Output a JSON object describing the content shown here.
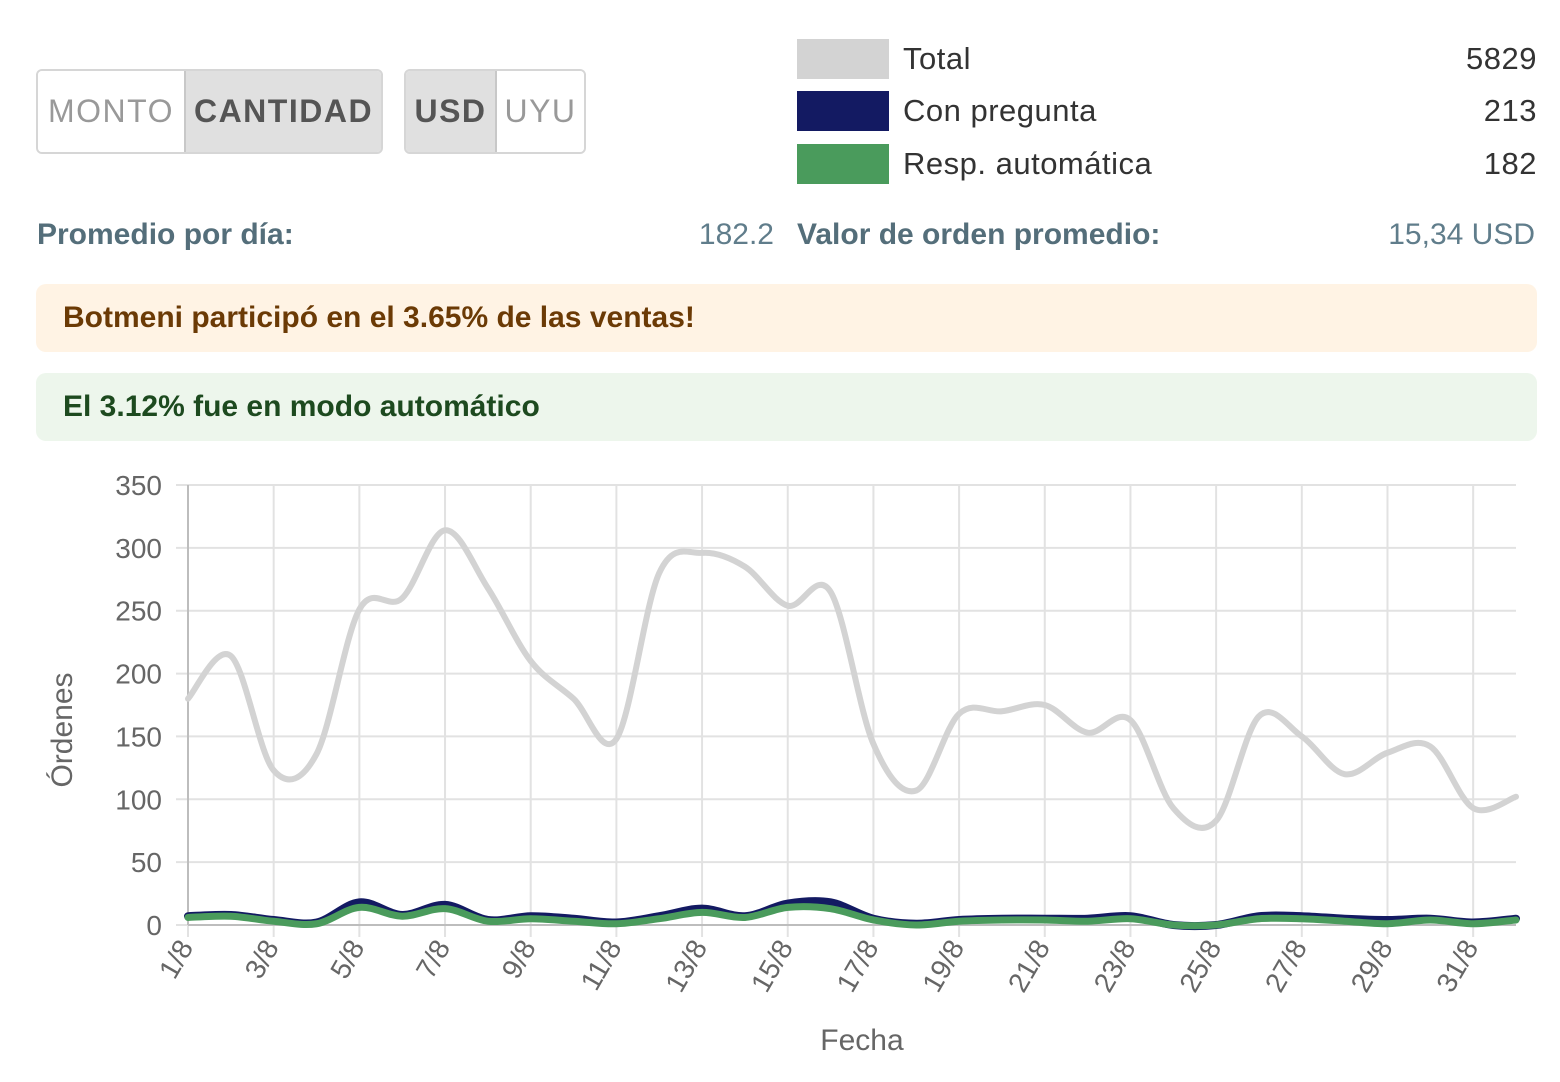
{
  "toggles": {
    "metric": {
      "options": [
        "MONTO",
        "CANTIDAD"
      ],
      "selected": "CANTIDAD"
    },
    "currency": {
      "options": [
        "USD",
        "UYU"
      ],
      "selected": "USD"
    }
  },
  "legend": [
    {
      "label": "Total",
      "value": "5829",
      "color": "#d3d3d3"
    },
    {
      "label": "Con pregunta",
      "value": "213",
      "color": "#131a62"
    },
    {
      "label": "Resp. automática",
      "value": "182",
      "color": "#4a9b5c"
    }
  ],
  "stats": {
    "avg_per_day_label": "Promedio por día:",
    "avg_per_day_value": "182.2",
    "avg_order_label": "Valor de orden promedio:",
    "avg_order_value": "15,34 USD"
  },
  "alerts": {
    "participation": "Botmeni participó en el 3.65% de las ventas!",
    "automatic": "El 3.12% fue en modo automático"
  },
  "chart_data": {
    "type": "line",
    "xlabel": "Fecha",
    "ylabel": "Órdenes",
    "ylim": [
      0,
      350
    ],
    "yticks": [
      0,
      50,
      100,
      150,
      200,
      250,
      300,
      350
    ],
    "grid": true,
    "x": [
      "1/8",
      "2/8",
      "3/8",
      "4/8",
      "5/8",
      "6/8",
      "7/8",
      "8/8",
      "9/8",
      "10/8",
      "11/8",
      "12/8",
      "13/8",
      "14/8",
      "15/8",
      "16/8",
      "17/8",
      "18/8",
      "19/8",
      "20/8",
      "21/8",
      "22/8",
      "23/8",
      "24/8",
      "25/8",
      "26/8",
      "27/8",
      "28/8",
      "29/8",
      "30/8",
      "31/8",
      "1/9"
    ],
    "xtick_labels": [
      "1/8",
      "3/8",
      "5/8",
      "7/8",
      "9/8",
      "11/8",
      "13/8",
      "15/8",
      "17/8",
      "19/8",
      "21/8",
      "23/8",
      "25/8",
      "27/8",
      "29/8",
      "31/8"
    ],
    "series": [
      {
        "name": "Total",
        "color": "#d3d3d3",
        "values": [
          180,
          214,
          123,
          136,
          251,
          260,
          314,
          268,
          210,
          180,
          148,
          280,
          296,
          285,
          254,
          265,
          144,
          107,
          168,
          170,
          175,
          153,
          163,
          93,
          83,
          166,
          150,
          120,
          137,
          142,
          93,
          102
        ]
      },
      {
        "name": "Con pregunta",
        "color": "#131a62",
        "values": [
          7,
          8,
          4,
          2,
          18,
          8,
          16,
          4,
          7,
          5,
          2,
          7,
          13,
          7,
          17,
          18,
          5,
          1,
          4,
          5,
          5,
          5,
          7,
          0,
          0,
          7,
          7,
          5,
          4,
          5,
          2,
          5
        ]
      },
      {
        "name": "Resp. automática",
        "color": "#4a9b5c",
        "values": [
          6,
          7,
          3,
          1,
          14,
          7,
          13,
          3,
          5,
          3,
          1,
          5,
          10,
          6,
          14,
          13,
          4,
          0,
          3,
          4,
          4,
          3,
          5,
          0,
          0,
          5,
          5,
          3,
          1,
          4,
          1,
          4
        ]
      }
    ]
  }
}
